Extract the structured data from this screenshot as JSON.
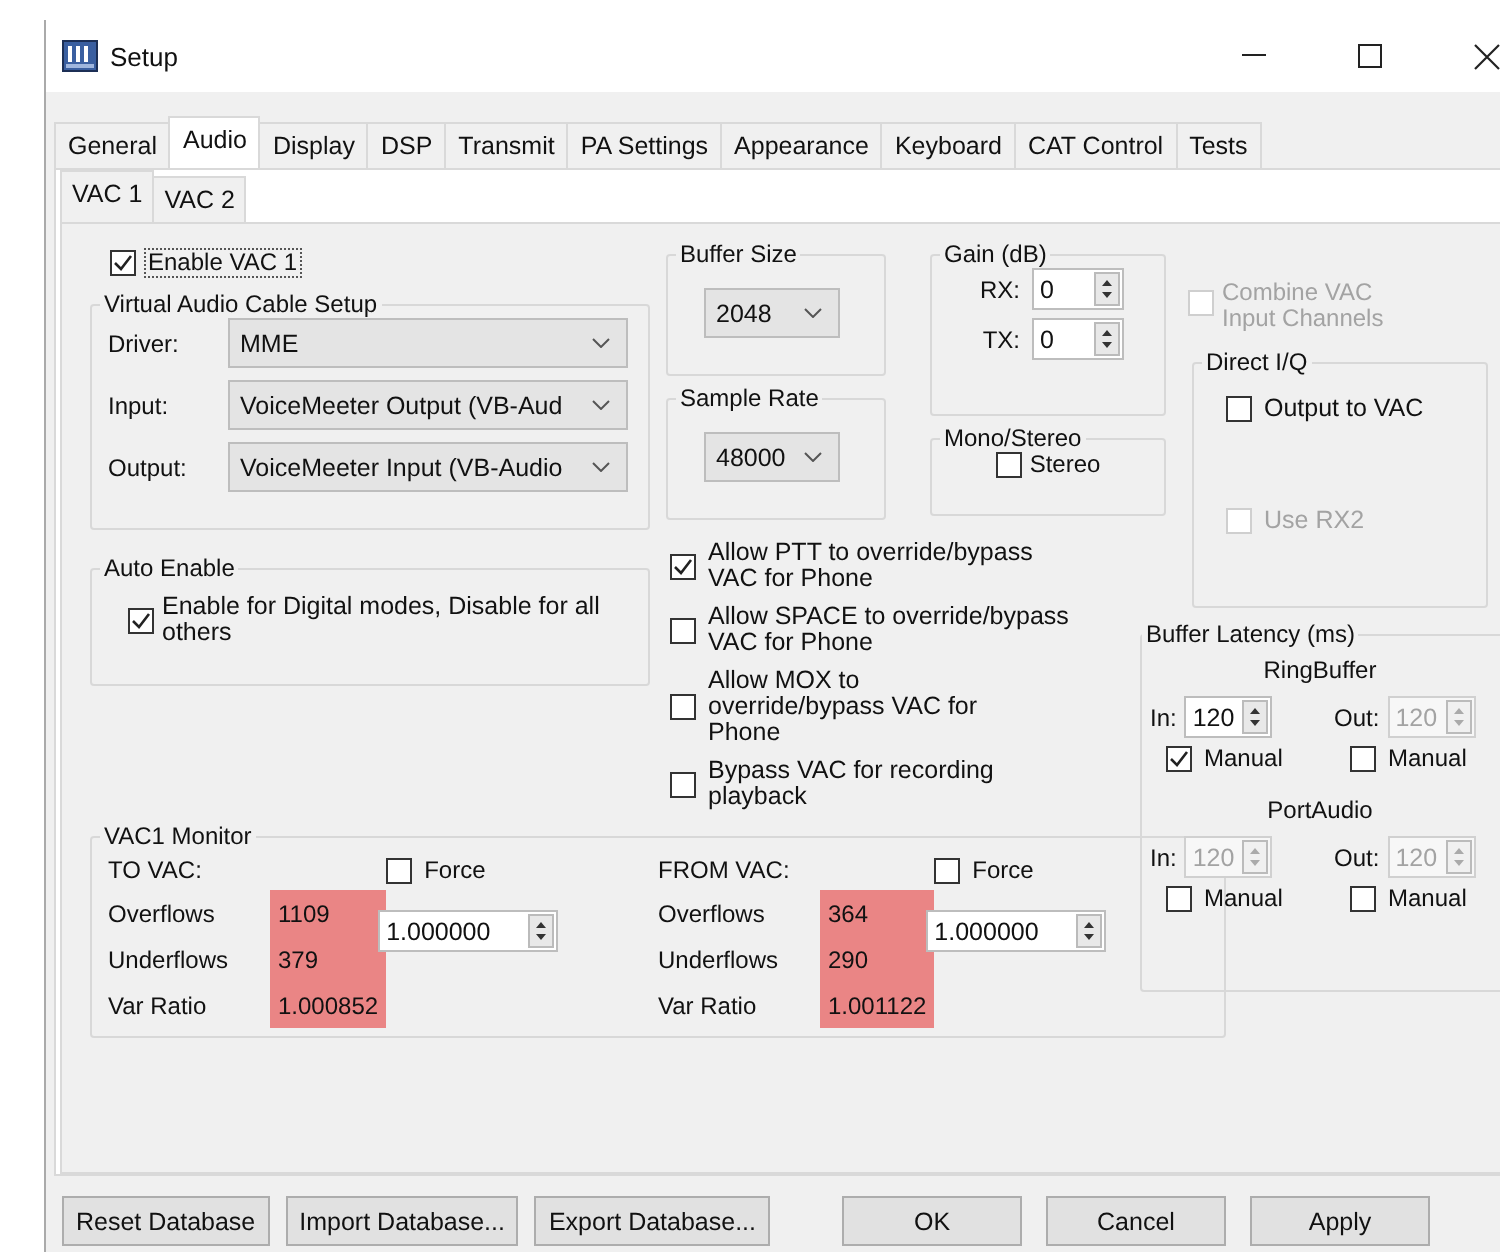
{
  "window": {
    "title": "Setup"
  },
  "tabs": [
    {
      "label": "General",
      "selected": false
    },
    {
      "label": "Audio",
      "selected": true
    },
    {
      "label": "Display",
      "selected": false
    },
    {
      "label": "DSP",
      "selected": false
    },
    {
      "label": "Transmit",
      "selected": false
    },
    {
      "label": "PA Settings",
      "selected": false
    },
    {
      "label": "Appearance",
      "selected": false
    },
    {
      "label": "Keyboard",
      "selected": false
    },
    {
      "label": "CAT Control",
      "selected": false
    },
    {
      "label": "Tests",
      "selected": false
    }
  ],
  "subtabs": [
    {
      "label": "VAC 1",
      "selected": true
    },
    {
      "label": "VAC 2",
      "selected": false
    }
  ],
  "enable_vac": {
    "label": "Enable VAC 1",
    "checked": true
  },
  "cable_setup": {
    "title": "Virtual Audio Cable Setup",
    "fields": [
      {
        "label": "Driver:",
        "value": "MME"
      },
      {
        "label": "Input:",
        "value": "VoiceMeeter Output (VB-Aud"
      },
      {
        "label": "Output:",
        "value": "VoiceMeeter Input (VB-Audio"
      }
    ]
  },
  "auto_enable": {
    "title": "Auto Enable",
    "checkbox": {
      "label": "Enable for Digital modes, Disable for all others",
      "checked": true
    }
  },
  "buffer_size": {
    "title": "Buffer Size",
    "value": "2048"
  },
  "sample_rate": {
    "title": "Sample Rate",
    "value": "48000"
  },
  "gain": {
    "title": "Gain (dB)",
    "fields": [
      {
        "label": "RX:",
        "value": "0"
      },
      {
        "label": "TX:",
        "value": "0"
      }
    ]
  },
  "mono_stereo": {
    "title": "Mono/Stereo",
    "checkbox": {
      "label": "Stereo",
      "checked": false
    }
  },
  "options": [
    {
      "label": "Allow PTT to override/bypass VAC for Phone",
      "checked": true
    },
    {
      "label": "Allow SPACE to override/bypass VAC for Phone",
      "checked": false
    },
    {
      "label": "Allow MOX to override/bypass VAC for Phone",
      "checked": false
    },
    {
      "label": "Bypass VAC for recording playback",
      "checked": false
    }
  ],
  "combine": {
    "label": "Combine VAC Input Channels",
    "checked": false,
    "disabled": true
  },
  "direct_iq": {
    "title": "Direct I/Q",
    "checkboxes": [
      {
        "label": "Output to VAC",
        "checked": false,
        "disabled": false
      },
      {
        "label": "Use RX2",
        "checked": false,
        "disabled": true
      }
    ]
  },
  "buffer_latency": {
    "title": "Buffer Latency (ms)",
    "sections": [
      {
        "title": "RingBuffer",
        "spinners": [
          {
            "label": "In:",
            "value": "120",
            "disabled": false,
            "manual": {
              "label": "Manual",
              "checked": true
            }
          },
          {
            "label": "Out:",
            "value": "120",
            "disabled": true,
            "manual": {
              "label": "Manual",
              "checked": false
            }
          }
        ]
      },
      {
        "title": "PortAudio",
        "spinners": [
          {
            "label": "In:",
            "value": "120",
            "disabled": true,
            "manual": {
              "label": "Manual",
              "checked": false
            }
          },
          {
            "label": "Out:",
            "value": "120",
            "disabled": true,
            "manual": {
              "label": "Manual",
              "checked": false
            }
          }
        ]
      }
    ]
  },
  "monitor": {
    "title": "VAC1 Monitor",
    "sides": [
      {
        "heading": "TO VAC:",
        "force": {
          "label": "Force",
          "checked": false
        },
        "ratio": "1.000000",
        "stats": [
          {
            "label": "Overflows",
            "value": "1109"
          },
          {
            "label": "Underflows",
            "value": "379"
          },
          {
            "label": "Var Ratio",
            "value": "1.000852"
          }
        ]
      },
      {
        "heading": "FROM VAC:",
        "force": {
          "label": "Force",
          "checked": false
        },
        "ratio": "1.000000",
        "stats": [
          {
            "label": "Overflows",
            "value": "364"
          },
          {
            "label": "Underflows",
            "value": "290"
          },
          {
            "label": "Var Ratio",
            "value": "1.001122"
          }
        ]
      }
    ]
  },
  "buttons": [
    {
      "label": "Reset Database",
      "kind": "left"
    },
    {
      "label": "Import Database...",
      "kind": "left"
    },
    {
      "label": "Export Database...",
      "kind": "left"
    },
    {
      "label": "OK",
      "kind": "right"
    },
    {
      "label": "Cancel",
      "kind": "right"
    },
    {
      "label": "Apply",
      "kind": "right"
    }
  ]
}
